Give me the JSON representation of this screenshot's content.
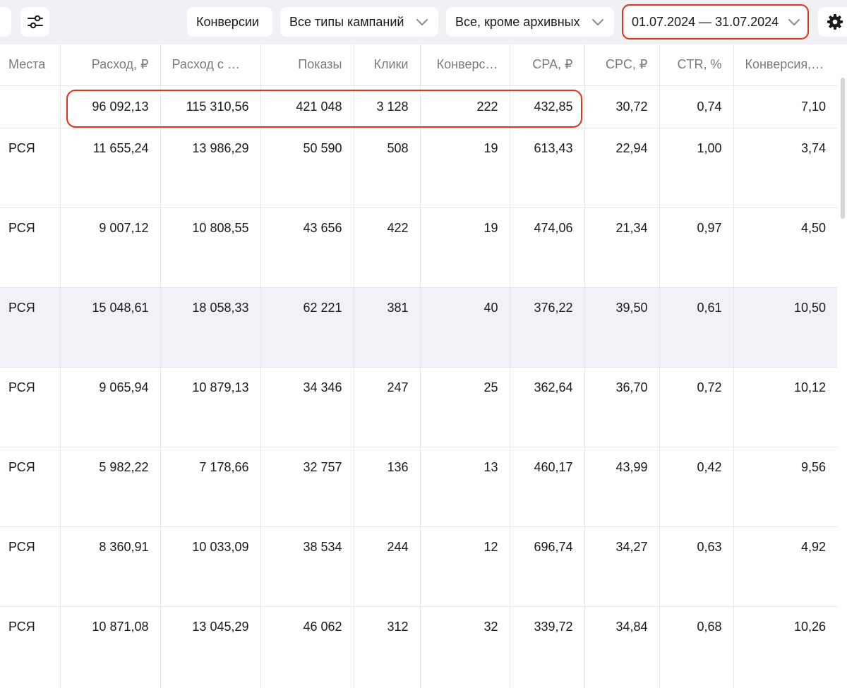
{
  "toolbar": {
    "conversions_label": "Конверсии",
    "campaign_types_label": "Все типы кампаний",
    "status_filter_label": "Все, кроме архивных",
    "date_range_label": "01.07.2024 — 31.07.2024"
  },
  "table": {
    "columns": [
      "Места",
      "Расход, ₽",
      "Расход с Н…",
      "Показы",
      "Клики",
      "Конверс…",
      "CPA, ₽",
      "CPC, ₽",
      "CTR, %",
      "Конверсия, %"
    ],
    "total": [
      "",
      "96 092,13",
      "115 310,56",
      "421 048",
      "3 128",
      "222",
      "432,85",
      "30,72",
      "0,74",
      "7,10"
    ],
    "rows": [
      [
        "РСЯ",
        "11 655,24",
        "13 986,29",
        "50 590",
        "508",
        "19",
        "613,43",
        "22,94",
        "1,00",
        "3,74"
      ],
      [
        "РСЯ",
        "9 007,12",
        "10 808,55",
        "43 656",
        "422",
        "19",
        "474,06",
        "21,34",
        "0,97",
        "4,50"
      ],
      [
        "РСЯ",
        "15 048,61",
        "18 058,33",
        "62 221",
        "381",
        "40",
        "376,22",
        "39,50",
        "0,61",
        "10,50"
      ],
      [
        "РСЯ",
        "9 065,94",
        "10 879,13",
        "34 346",
        "247",
        "25",
        "362,64",
        "36,70",
        "0,72",
        "10,12"
      ],
      [
        "РСЯ",
        "5 982,22",
        "7 178,66",
        "32 757",
        "136",
        "13",
        "460,17",
        "43,99",
        "0,42",
        "9,56"
      ],
      [
        "РСЯ",
        "8 360,91",
        "10 033,09",
        "38 534",
        "244",
        "12",
        "696,74",
        "34,27",
        "0,63",
        "4,92"
      ],
      [
        "РСЯ",
        "10 871,08",
        "13 045,29",
        "46 062",
        "312",
        "32",
        "339,72",
        "34,84",
        "0,68",
        "10,26"
      ]
    ]
  },
  "highlight_color": "#e0341e"
}
